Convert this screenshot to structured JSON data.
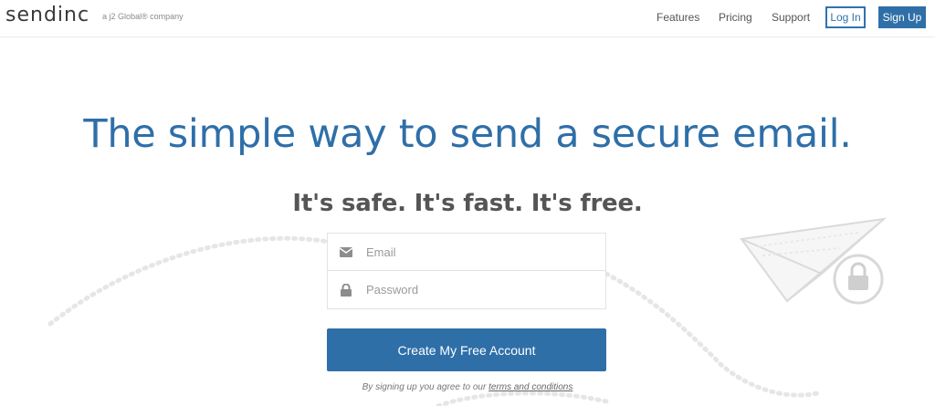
{
  "header": {
    "logo": "sendinc",
    "tagline": "a j2 Global® company",
    "nav": [
      "Features",
      "Pricing",
      "Support"
    ],
    "login_label": "Log In",
    "signup_label": "Sign Up"
  },
  "hero": {
    "title": "The simple way to send a secure email.",
    "subtitle": "It's safe. It's fast. It's free."
  },
  "form": {
    "email_placeholder": "Email",
    "password_placeholder": "Password",
    "submit_label": "Create My Free Account",
    "terms_prefix": "By signing up you agree to our ",
    "terms_link": "terms and conditions"
  },
  "colors": {
    "brand": "#2f6fa8",
    "heading": "#2f6fa8",
    "text": "#555555"
  },
  "icons": [
    "envelope-icon",
    "lock-icon",
    "paper-plane-icon",
    "padlock-icon"
  ]
}
